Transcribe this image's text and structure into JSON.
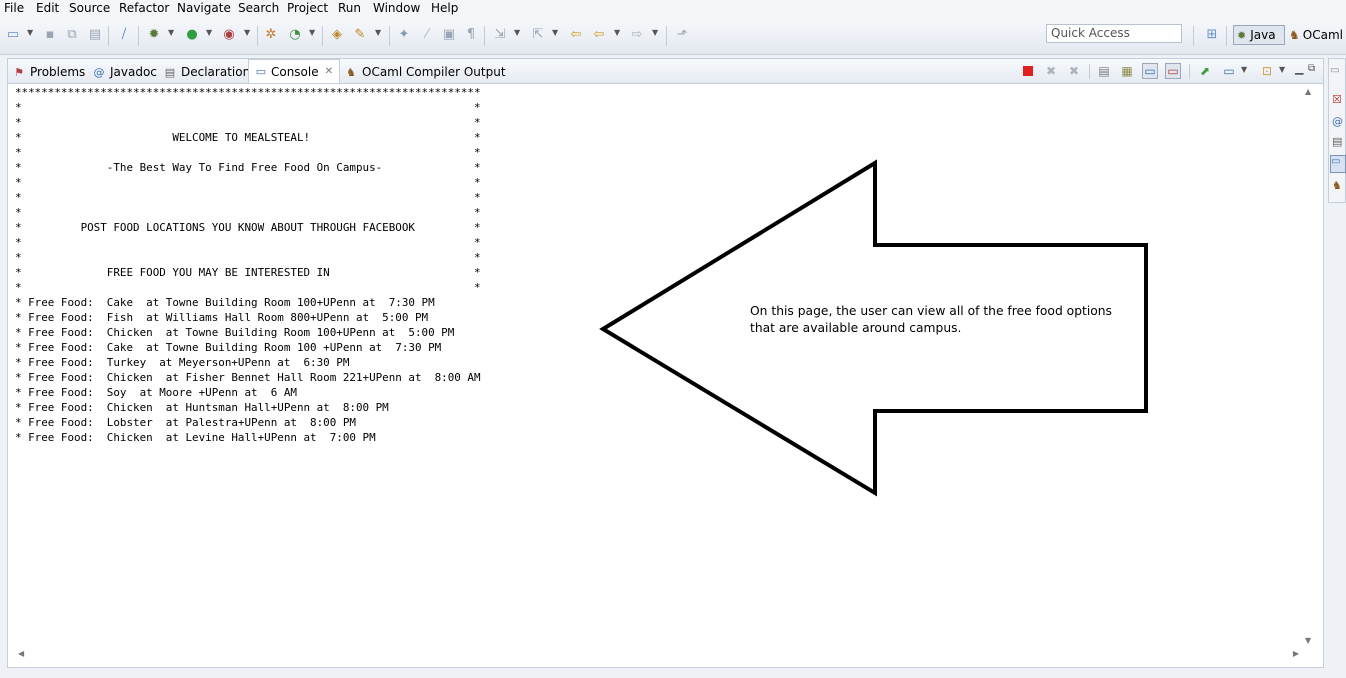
{
  "menu": [
    "File",
    "Edit",
    "Source",
    "Refactor",
    "Navigate",
    "Search",
    "Project",
    "Run",
    "Window",
    "Help"
  ],
  "quick_access": {
    "placeholder": "Quick Access"
  },
  "perspectives": {
    "java": "Java",
    "ocaml": "OCaml"
  },
  "tabs": [
    {
      "label": "Problems",
      "icon": "problems-icon"
    },
    {
      "label": "Javadoc",
      "icon": "javadoc-at-icon"
    },
    {
      "label": "Declaration",
      "icon": "declaration-icon"
    },
    {
      "label": "Console",
      "icon": "console-icon",
      "active": true
    },
    {
      "label": "OCaml Compiler Output",
      "icon": "ocaml-camel-icon"
    }
  ],
  "console_lines": [
    "***********************************************************************",
    "*                                                                     *",
    "*                                                                     *",
    "*                       WELCOME TO MEALSTEAL!                         *",
    "*                                                                     *",
    "*             -The Best Way To Find Free Food On Campus-              *",
    "*                                                                     *",
    "*                                                                     *",
    "*                                                                     *",
    "*         POST FOOD LOCATIONS YOU KNOW ABOUT THROUGH FACEBOOK         *",
    "*                                                                     *",
    "*                                                                     *",
    "*             FREE FOOD YOU MAY BE INTERESTED IN                      *",
    "*                                                                     *",
    "* Free Food:  Cake  at Towne Building Room 100+UPenn at  7:30 PM",
    "* Free Food:  Fish  at Williams Hall Room 800+UPenn at  5:00 PM",
    "* Free Food:  Chicken  at Towne Building Room 100+UPenn at  5:00 PM",
    "* Free Food:  Cake  at Towne Building Room 100 +UPenn at  7:30 PM",
    "* Free Food:  Turkey  at Meyerson+UPenn at  6:30 PM",
    "* Free Food:  Chicken  at Fisher Bennet Hall Room 221+UPenn at  8:00 AM",
    "* Free Food:  Soy  at Moore +UPenn at  6 AM",
    "* Free Food:  Chicken  at Huntsman Hall+UPenn at  8:00 PM",
    "* Free Food:  Lobster  at Palestra+UPenn at  8:00 PM",
    "* Free Food:  Chicken  at Levine Hall+UPenn at  7:00 PM"
  ],
  "annotation": "On this page, the user can view all of the free food options that are available around campus.",
  "colors": {
    "terminate_red": "#e02020",
    "toolbar_bg": "#e8edf4",
    "panel_border": "#c5cedb"
  }
}
